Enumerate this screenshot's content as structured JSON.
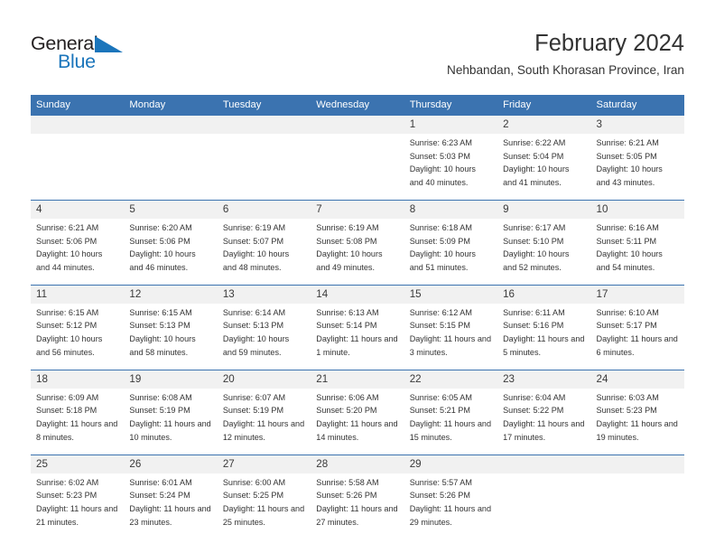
{
  "brand": {
    "name_dark": "General",
    "name_blue": "Blue",
    "accent_color": "#1b75bb"
  },
  "header": {
    "title": "February 2024",
    "subtitle": "Nehbandan, South Khorasan Province, Iran"
  },
  "theme": {
    "header_blue": "#3b73b0",
    "daynum_gray": "#f1f1f1",
    "text": "#333333"
  },
  "calendar": {
    "day_headers": [
      "Sunday",
      "Monday",
      "Tuesday",
      "Wednesday",
      "Thursday",
      "Friday",
      "Saturday"
    ],
    "weeks": [
      {
        "numbers": [
          "",
          "",
          "",
          "",
          "1",
          "2",
          "3"
        ],
        "cells": [
          {
            "sunrise": "",
            "sunset": "",
            "daylight": ""
          },
          {
            "sunrise": "",
            "sunset": "",
            "daylight": ""
          },
          {
            "sunrise": "",
            "sunset": "",
            "daylight": ""
          },
          {
            "sunrise": "",
            "sunset": "",
            "daylight": ""
          },
          {
            "sunrise": "Sunrise: 6:23 AM",
            "sunset": "Sunset: 5:03 PM",
            "daylight": "Daylight: 10 hours and 40 minutes."
          },
          {
            "sunrise": "Sunrise: 6:22 AM",
            "sunset": "Sunset: 5:04 PM",
            "daylight": "Daylight: 10 hours and 41 minutes."
          },
          {
            "sunrise": "Sunrise: 6:21 AM",
            "sunset": "Sunset: 5:05 PM",
            "daylight": "Daylight: 10 hours and 43 minutes."
          }
        ]
      },
      {
        "numbers": [
          "4",
          "5",
          "6",
          "7",
          "8",
          "9",
          "10"
        ],
        "cells": [
          {
            "sunrise": "Sunrise: 6:21 AM",
            "sunset": "Sunset: 5:06 PM",
            "daylight": "Daylight: 10 hours and 44 minutes."
          },
          {
            "sunrise": "Sunrise: 6:20 AM",
            "sunset": "Sunset: 5:06 PM",
            "daylight": "Daylight: 10 hours and 46 minutes."
          },
          {
            "sunrise": "Sunrise: 6:19 AM",
            "sunset": "Sunset: 5:07 PM",
            "daylight": "Daylight: 10 hours and 48 minutes."
          },
          {
            "sunrise": "Sunrise: 6:19 AM",
            "sunset": "Sunset: 5:08 PM",
            "daylight": "Daylight: 10 hours and 49 minutes."
          },
          {
            "sunrise": "Sunrise: 6:18 AM",
            "sunset": "Sunset: 5:09 PM",
            "daylight": "Daylight: 10 hours and 51 minutes."
          },
          {
            "sunrise": "Sunrise: 6:17 AM",
            "sunset": "Sunset: 5:10 PM",
            "daylight": "Daylight: 10 hours and 52 minutes."
          },
          {
            "sunrise": "Sunrise: 6:16 AM",
            "sunset": "Sunset: 5:11 PM",
            "daylight": "Daylight: 10 hours and 54 minutes."
          }
        ]
      },
      {
        "numbers": [
          "11",
          "12",
          "13",
          "14",
          "15",
          "16",
          "17"
        ],
        "cells": [
          {
            "sunrise": "Sunrise: 6:15 AM",
            "sunset": "Sunset: 5:12 PM",
            "daylight": "Daylight: 10 hours and 56 minutes."
          },
          {
            "sunrise": "Sunrise: 6:15 AM",
            "sunset": "Sunset: 5:13 PM",
            "daylight": "Daylight: 10 hours and 58 minutes."
          },
          {
            "sunrise": "Sunrise: 6:14 AM",
            "sunset": "Sunset: 5:13 PM",
            "daylight": "Daylight: 10 hours and 59 minutes."
          },
          {
            "sunrise": "Sunrise: 6:13 AM",
            "sunset": "Sunset: 5:14 PM",
            "daylight": "Daylight: 11 hours and 1 minute."
          },
          {
            "sunrise": "Sunrise: 6:12 AM",
            "sunset": "Sunset: 5:15 PM",
            "daylight": "Daylight: 11 hours and 3 minutes."
          },
          {
            "sunrise": "Sunrise: 6:11 AM",
            "sunset": "Sunset: 5:16 PM",
            "daylight": "Daylight: 11 hours and 5 minutes."
          },
          {
            "sunrise": "Sunrise: 6:10 AM",
            "sunset": "Sunset: 5:17 PM",
            "daylight": "Daylight: 11 hours and 6 minutes."
          }
        ]
      },
      {
        "numbers": [
          "18",
          "19",
          "20",
          "21",
          "22",
          "23",
          "24"
        ],
        "cells": [
          {
            "sunrise": "Sunrise: 6:09 AM",
            "sunset": "Sunset: 5:18 PM",
            "daylight": "Daylight: 11 hours and 8 minutes."
          },
          {
            "sunrise": "Sunrise: 6:08 AM",
            "sunset": "Sunset: 5:19 PM",
            "daylight": "Daylight: 11 hours and 10 minutes."
          },
          {
            "sunrise": "Sunrise: 6:07 AM",
            "sunset": "Sunset: 5:19 PM",
            "daylight": "Daylight: 11 hours and 12 minutes."
          },
          {
            "sunrise": "Sunrise: 6:06 AM",
            "sunset": "Sunset: 5:20 PM",
            "daylight": "Daylight: 11 hours and 14 minutes."
          },
          {
            "sunrise": "Sunrise: 6:05 AM",
            "sunset": "Sunset: 5:21 PM",
            "daylight": "Daylight: 11 hours and 15 minutes."
          },
          {
            "sunrise": "Sunrise: 6:04 AM",
            "sunset": "Sunset: 5:22 PM",
            "daylight": "Daylight: 11 hours and 17 minutes."
          },
          {
            "sunrise": "Sunrise: 6:03 AM",
            "sunset": "Sunset: 5:23 PM",
            "daylight": "Daylight: 11 hours and 19 minutes."
          }
        ]
      },
      {
        "numbers": [
          "25",
          "26",
          "27",
          "28",
          "29",
          "",
          ""
        ],
        "cells": [
          {
            "sunrise": "Sunrise: 6:02 AM",
            "sunset": "Sunset: 5:23 PM",
            "daylight": "Daylight: 11 hours and 21 minutes."
          },
          {
            "sunrise": "Sunrise: 6:01 AM",
            "sunset": "Sunset: 5:24 PM",
            "daylight": "Daylight: 11 hours and 23 minutes."
          },
          {
            "sunrise": "Sunrise: 6:00 AM",
            "sunset": "Sunset: 5:25 PM",
            "daylight": "Daylight: 11 hours and 25 minutes."
          },
          {
            "sunrise": "Sunrise: 5:58 AM",
            "sunset": "Sunset: 5:26 PM",
            "daylight": "Daylight: 11 hours and 27 minutes."
          },
          {
            "sunrise": "Sunrise: 5:57 AM",
            "sunset": "Sunset: 5:26 PM",
            "daylight": "Daylight: 11 hours and 29 minutes."
          },
          {
            "sunrise": "",
            "sunset": "",
            "daylight": ""
          },
          {
            "sunrise": "",
            "sunset": "",
            "daylight": ""
          }
        ]
      }
    ]
  }
}
